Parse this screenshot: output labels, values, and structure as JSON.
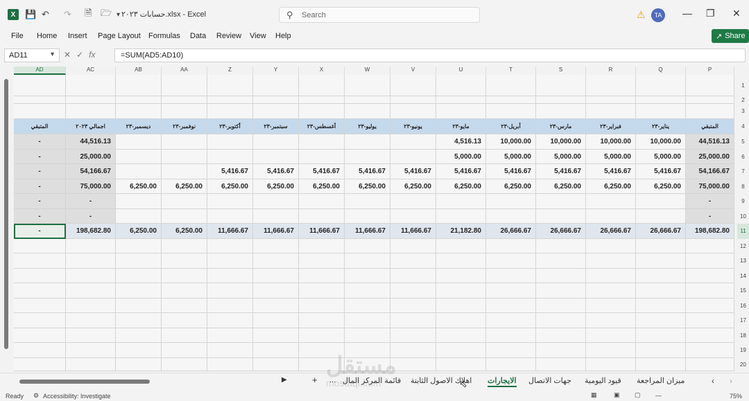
{
  "titlebar": {
    "app_logo": "X",
    "doc_title": "حسابات ٢٠٢٣.xlsx  -  Excel",
    "search_placeholder": "Search",
    "avatar": "TA"
  },
  "menu": [
    "File",
    "Home",
    "Insert",
    "Page Layout",
    "Formulas",
    "Data",
    "Review",
    "View",
    "Help"
  ],
  "share_label": "Share",
  "formula_bar": {
    "name_box": "AD11",
    "formula": "=SUM(AD5:AD10)"
  },
  "columns": [
    "AD",
    "AC",
    "AB",
    "AA",
    "Z",
    "Y",
    "X",
    "W",
    "V",
    "U",
    "T",
    "S",
    "R",
    "Q",
    "P"
  ],
  "rows": [
    "1",
    "2",
    "3",
    "4",
    "5",
    "6",
    "7",
    "8",
    "9",
    "10",
    "11",
    "12",
    "13",
    "14",
    "15",
    "16",
    "17",
    "18",
    "19",
    "20"
  ],
  "table": {
    "headers": [
      "المتبقي",
      "اجمالي ٢٠٢٣",
      "ديسمبر-٢٣",
      "نوفمبر-٢٣",
      "أكتوبر-٢٣",
      "سبتمبر-٢٣",
      "أغسطس-٢٣",
      "يوليو-٢٣",
      "يونيو-٢٣",
      "مايو-٢٣",
      "أبريل-٢٣",
      "مارس-٢٣",
      "فبراير-٢٣",
      "يناير-٢٣",
      "المتبقي"
    ],
    "data": [
      [
        "-",
        "44,516.13",
        "",
        "",
        "",
        "",
        "",
        "",
        "",
        "4,516.13",
        "10,000.00",
        "10,000.00",
        "10,000.00",
        "10,000.00",
        "44,516.13"
      ],
      [
        "-",
        "25,000.00",
        "",
        "",
        "",
        "",
        "",
        "",
        "",
        "5,000.00",
        "5,000.00",
        "5,000.00",
        "5,000.00",
        "5,000.00",
        "25,000.00"
      ],
      [
        "-",
        "54,166.67",
        "",
        "",
        "5,416.67",
        "5,416.67",
        "5,416.67",
        "5,416.67",
        "5,416.67",
        "5,416.67",
        "5,416.67",
        "5,416.67",
        "5,416.67",
        "5,416.67",
        "54,166.67"
      ],
      [
        "-",
        "75,000.00",
        "6,250.00",
        "6,250.00",
        "6,250.00",
        "6,250.00",
        "6,250.00",
        "6,250.00",
        "6,250.00",
        "6,250.00",
        "6,250.00",
        "6,250.00",
        "6,250.00",
        "6,250.00",
        "75,000.00"
      ],
      [
        "-",
        "-",
        "",
        "",
        "",
        "",
        "",
        "",
        "",
        "",
        "",
        "",
        "",
        "",
        "-"
      ],
      [
        "-",
        "-",
        "",
        "",
        "",
        "",
        "",
        "",
        "",
        "",
        "",
        "",
        "",
        "",
        "-"
      ]
    ],
    "totals": [
      "-",
      "198,682.80",
      "6,250.00",
      "6,250.00",
      "11,666.67",
      "11,666.67",
      "11,666.67",
      "11,666.67",
      "11,666.67",
      "21,182.80",
      "26,666.67",
      "26,666.67",
      "26,666.67",
      "26,666.67",
      "198,682.80"
    ]
  },
  "sheet_tabs": [
    "ميزان المراجعة",
    "قيود اليومية",
    "جهات الاتصال",
    "الايجارات",
    "اهلاك الاصول الثابتة",
    "قائمة المركز المال",
    "..."
  ],
  "active_tab": "الايجارات",
  "status": {
    "ready": "Ready",
    "accessibility": "Accessibility: Investigate",
    "zoom": "75%"
  },
  "watermark": "مستقل",
  "watermark_sub": "mostaql.com"
}
